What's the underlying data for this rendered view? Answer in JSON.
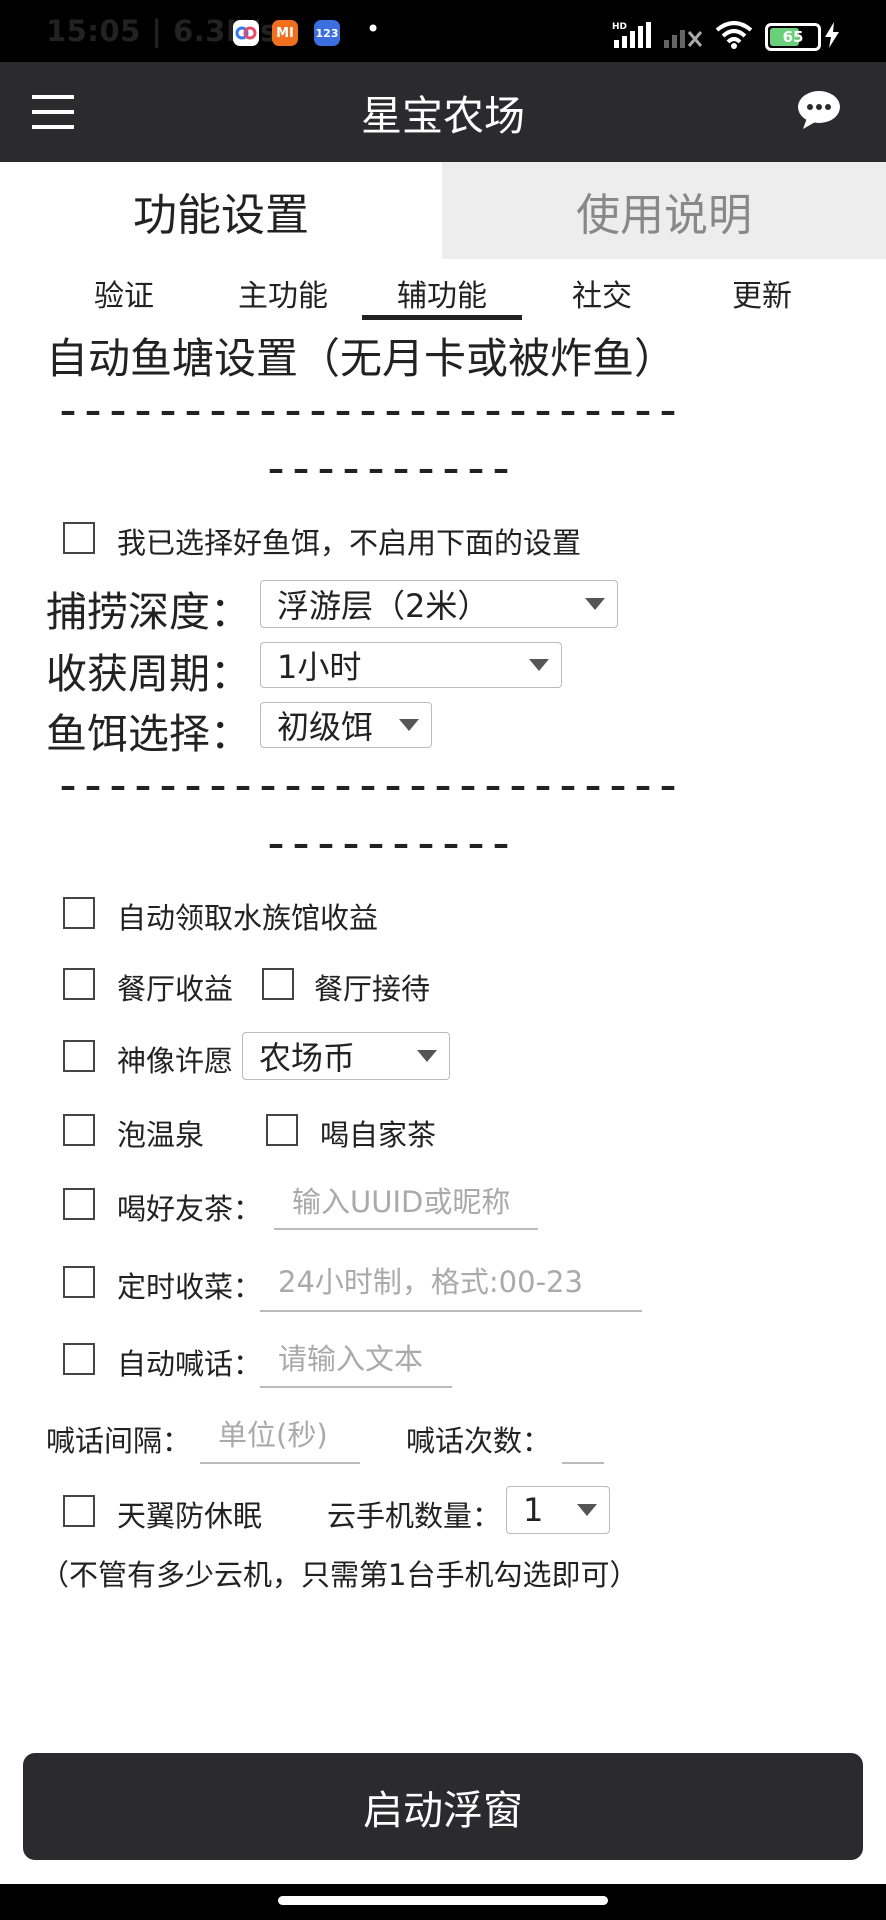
{
  "status_bar": {
    "time_speed": "15:05 | 6.3K/s",
    "app_icons": [
      {
        "name": "baidu-netdisk-icon",
        "label": "",
        "color": "#ffffff"
      },
      {
        "name": "xiaomi-icon",
        "label": "MI",
        "color": "#f07020"
      },
      {
        "name": "123pan-icon",
        "label": "123",
        "color": "#3b6fe0"
      }
    ],
    "dot": "•",
    "battery": "65",
    "battery_level": 0.65
  },
  "app_bar": {
    "title": "星宝农场",
    "menu_icon": "menu-icon",
    "chat_icon": "chat-bubble-icon"
  },
  "main_tabs": [
    {
      "label": "功能设置",
      "active": true
    },
    {
      "label": "使用说明",
      "active": false
    }
  ],
  "sub_tabs": [
    "验证",
    "主功能",
    "辅功能",
    "社交",
    "更新"
  ],
  "active_sub_tab": "辅功能",
  "fishpond": {
    "heading": "自动鱼塘设置（无月卡或被炸鱼）",
    "dash_long": "–––––––––––––––––––––––––",
    "dash_short": "––––––––––",
    "skip_label": "我已选择好鱼饵，不启用下面的设置",
    "depth_label": "捕捞深度：",
    "depth_value": "浮游层（2米）",
    "cycle_label": "收获周期：",
    "cycle_value": "1小时",
    "bait_label": "鱼饵选择：",
    "bait_value": "初级饵"
  },
  "options": {
    "aquarium": "自动领取水族馆收益",
    "restaurant_income": "餐厅收益",
    "restaurant_reception": "餐厅接待",
    "statue_wish": "神像许愿",
    "statue_wish_value": "农场币",
    "hot_spring": "泡温泉",
    "home_tea": "喝自家茶",
    "friend_tea": "喝好友茶：",
    "friend_tea_placeholder": "输入UUID或昵称",
    "timed_harvest": "定时收菜：",
    "timed_harvest_placeholder": "24小时制，格式:00-23",
    "auto_shout": "自动喊话：",
    "auto_shout_placeholder": "请输入文本",
    "shout_interval": "喊话间隔：",
    "shout_interval_placeholder": "单位(秒)",
    "shout_count": "喊话次数：",
    "shout_count_placeholder": "",
    "anti_sleep": "天翼防休眠",
    "cloud_phone_count_label": "云手机数量：",
    "cloud_phone_count_value": "1",
    "note": "（不管有多少云机，只需第1台手机勾选即可）"
  },
  "start_button": "启动浮窗"
}
